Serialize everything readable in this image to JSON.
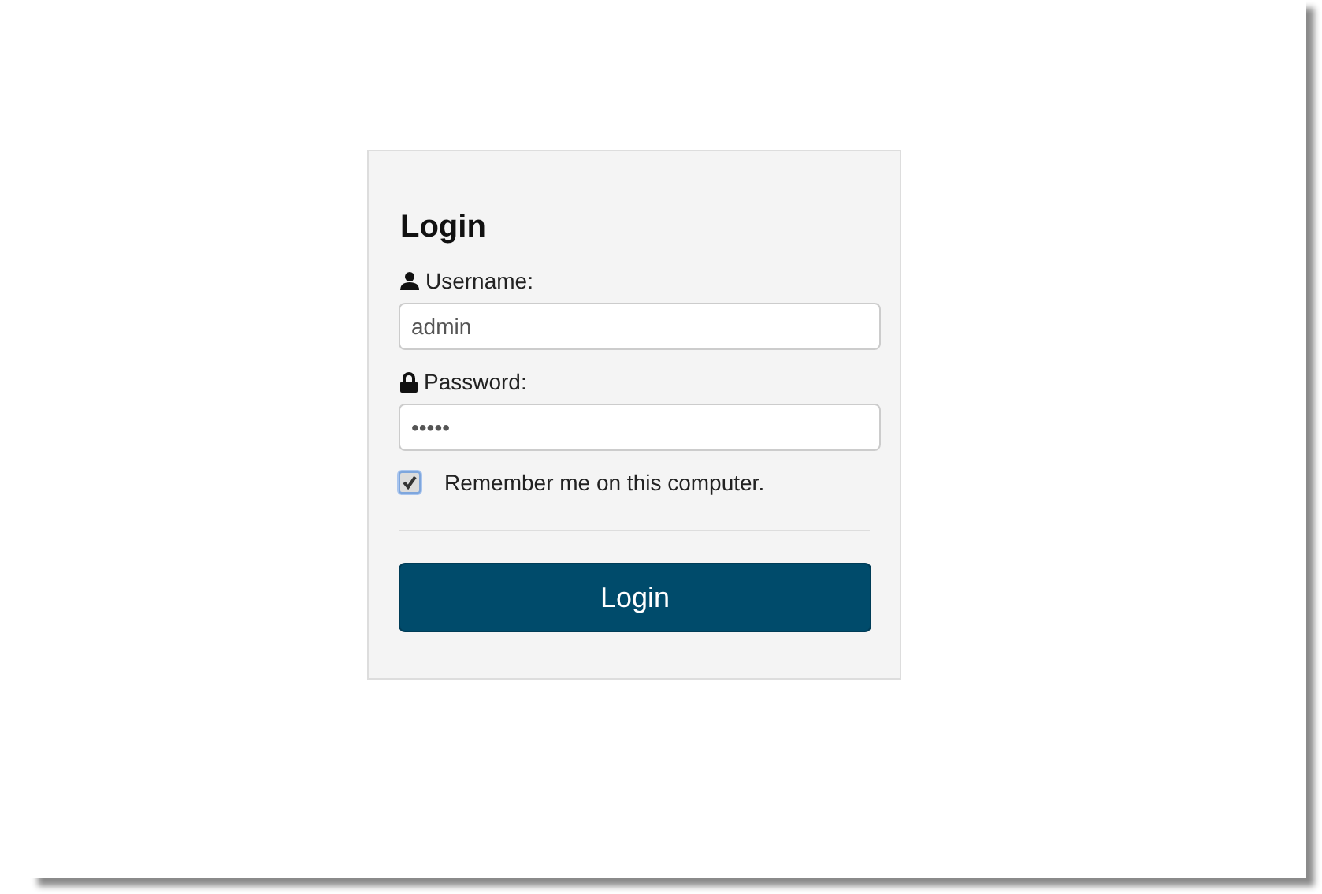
{
  "login_form": {
    "title": "Login",
    "fields": [
      {
        "kind": "user",
        "label": "Username:",
        "value": "admin"
      },
      {
        "kind": "lock",
        "label": "Password:",
        "value": "•••••"
      }
    ],
    "remember": {
      "label": "Remember me on this computer.",
      "checked": true
    },
    "button": "Login"
  }
}
